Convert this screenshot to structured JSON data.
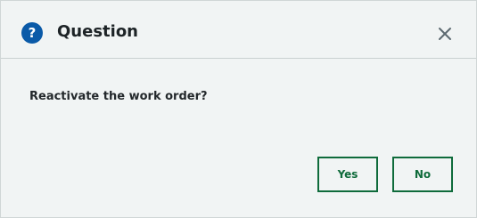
{
  "dialog": {
    "icon": "question-circle-icon",
    "icon_glyph": "?",
    "title": "Question",
    "close_icon": "close-icon",
    "message": "Reactivate the work order?",
    "buttons": {
      "yes_label": "Yes",
      "no_label": "No"
    }
  },
  "colors": {
    "background": "#f1f4f4",
    "icon_blue": "#0a5aa8",
    "button_green": "#0f6b3b",
    "text_dark": "#1d2326"
  }
}
